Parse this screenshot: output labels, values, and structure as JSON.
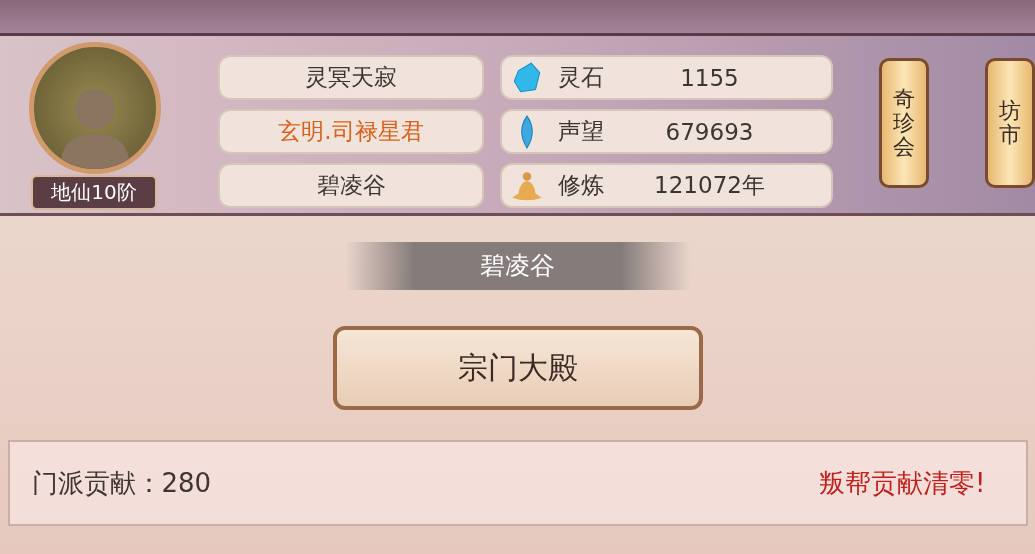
{
  "player": {
    "rank": "地仙10阶"
  },
  "info": [
    {
      "kind": "name",
      "text": "灵冥天寂"
    },
    {
      "kind": "title",
      "text": "玄明.司禄星君"
    },
    {
      "kind": "sect",
      "text": "碧凌谷"
    }
  ],
  "stats": [
    {
      "kind": "stone",
      "label": "灵石",
      "value": "1155"
    },
    {
      "kind": "reputation",
      "label": "声望",
      "value": "679693"
    },
    {
      "kind": "cultivation",
      "label": "修炼",
      "value": "121072年"
    }
  ],
  "lanterns": [
    {
      "label": "奇珍会"
    },
    {
      "label": "坊市"
    }
  ],
  "sect_title": "碧凌谷",
  "hall_button": "宗门大殿",
  "footer": {
    "contribution": "门派贡献：280",
    "warning": "叛帮贡献清零!"
  }
}
